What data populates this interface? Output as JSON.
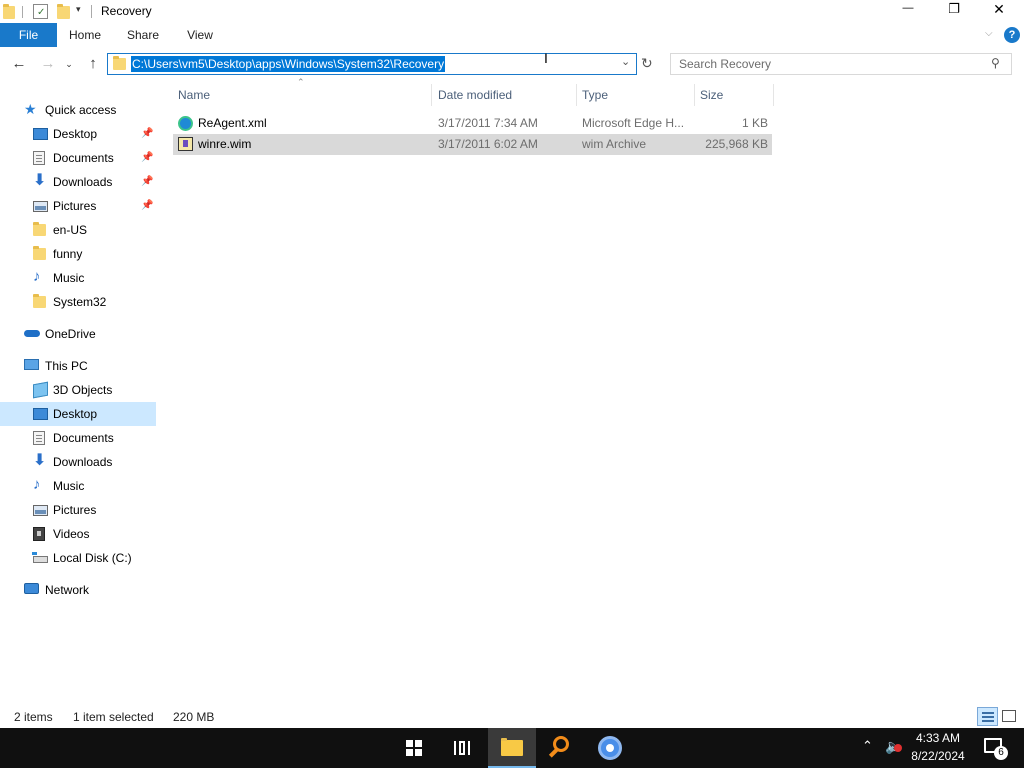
{
  "window": {
    "title": "Recovery",
    "controls": {
      "minimize": "—",
      "maximize": "❐",
      "close": "✕"
    }
  },
  "ribbon": {
    "tabs": [
      "File",
      "Home",
      "Share",
      "View"
    ],
    "expand_icon": "chevron-down-icon",
    "help": "?"
  },
  "address": {
    "path": "C:\\Users\\vm5\\Desktop\\apps\\Windows\\System32\\Recovery",
    "search_placeholder": "Search Recovery"
  },
  "sidebar": {
    "quick_access": {
      "label": "Quick access",
      "items": [
        {
          "label": "Desktop",
          "icon": "desktop-icon",
          "pinned": true
        },
        {
          "label": "Documents",
          "icon": "documents-icon",
          "pinned": true
        },
        {
          "label": "Downloads",
          "icon": "downloads-icon",
          "pinned": true
        },
        {
          "label": "Pictures",
          "icon": "pictures-icon",
          "pinned": true
        },
        {
          "label": "en-US",
          "icon": "folder-icon",
          "pinned": false
        },
        {
          "label": "funny",
          "icon": "folder-icon",
          "pinned": false
        },
        {
          "label": "Music",
          "icon": "music-icon",
          "pinned": false
        },
        {
          "label": "System32",
          "icon": "folder-icon",
          "pinned": false
        }
      ]
    },
    "onedrive": {
      "label": "OneDrive"
    },
    "this_pc": {
      "label": "This PC",
      "items": [
        {
          "label": "3D Objects",
          "icon": "3d-objects-icon"
        },
        {
          "label": "Desktop",
          "icon": "desktop-icon",
          "selected": true
        },
        {
          "label": "Documents",
          "icon": "documents-icon"
        },
        {
          "label": "Downloads",
          "icon": "downloads-icon"
        },
        {
          "label": "Music",
          "icon": "music-icon"
        },
        {
          "label": "Pictures",
          "icon": "pictures-icon"
        },
        {
          "label": "Videos",
          "icon": "videos-icon"
        },
        {
          "label": "Local Disk (C:)",
          "icon": "local-disk-icon"
        }
      ]
    },
    "network": {
      "label": "Network"
    }
  },
  "columns": {
    "name": "Name",
    "date": "Date modified",
    "type": "Type",
    "size": "Size"
  },
  "files": [
    {
      "name": "ReAgent.xml",
      "date": "3/17/2011 7:34 AM",
      "type": "Microsoft Edge H...",
      "size": "1 KB",
      "icon": "edge-document-icon",
      "selected": false
    },
    {
      "name": "winre.wim",
      "date": "3/17/2011 6:02 AM",
      "type": "wim Archive",
      "size": "225,968 KB",
      "icon": "archive-icon",
      "selected": true
    }
  ],
  "status": {
    "items": "2 items",
    "selection": "1 item selected",
    "size": "220 MB"
  },
  "taskbar": {
    "time": "4:33 AM",
    "date": "8/22/2024",
    "notifications": "6"
  },
  "colors": {
    "accent": "#1979ca",
    "selection": "#cce8ff",
    "taskbar": "#101010"
  }
}
